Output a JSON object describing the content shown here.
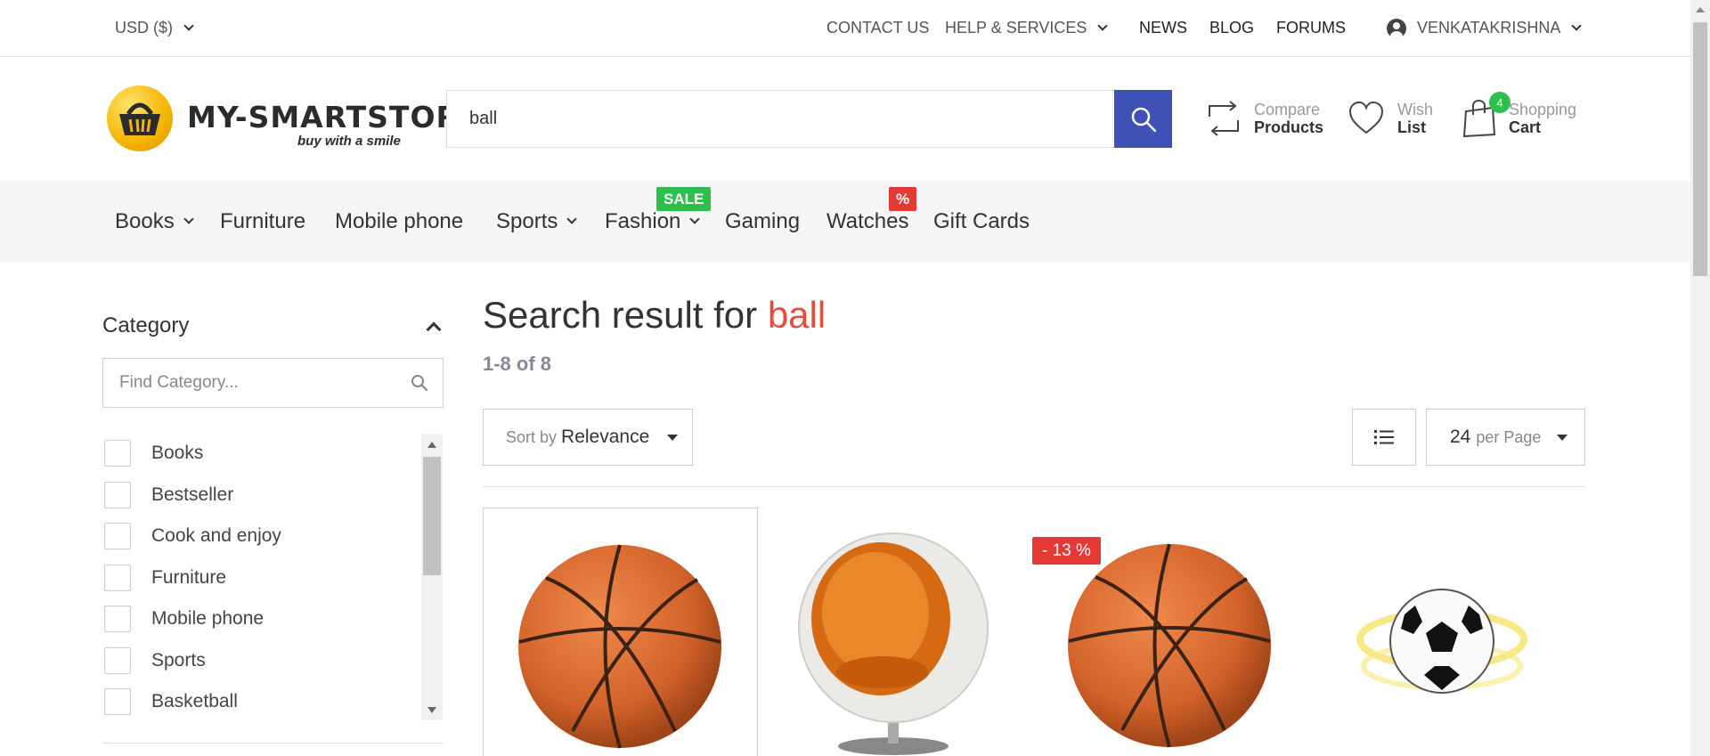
{
  "topbar": {
    "currency": "USD  ($)",
    "contact": "CONTACT US",
    "help": "HELP & SERVICES",
    "news": "NEWS",
    "blog": "BLOG",
    "forums": "FORUMS",
    "user": "VENKATAKRISHNA"
  },
  "logo": {
    "title": "MY-SMARTSTORE",
    "tagline": "buy with a smile"
  },
  "search": {
    "value": "ball"
  },
  "header_links": {
    "compare_small": "Compare",
    "compare_big": "Products",
    "wish_small": "Wish",
    "wish_big": "List",
    "cart_small": "Shopping",
    "cart_big": "Cart",
    "cart_count": "4"
  },
  "nav": {
    "items": [
      "Books",
      "Furniture",
      "Mobile phone",
      "Sports",
      "Fashion",
      "Gaming",
      "Watches",
      "Gift Cards"
    ],
    "sale_badge": "SALE",
    "percent_badge": "%"
  },
  "sidebar": {
    "title": "Category",
    "search_placeholder": "Find Category...",
    "categories": [
      "Books",
      "Bestseller",
      "Cook and enjoy",
      "Furniture",
      "Mobile phone",
      "Sports",
      "Basketball"
    ]
  },
  "results": {
    "title_prefix": "Search result for",
    "query": "ball",
    "count": "1-8 of 8",
    "sort_prefix": "Sort by",
    "sort_value": "Relevance",
    "per_page_value": "24",
    "per_page_suffix": "per Page",
    "discount_badge": "- 13 %"
  },
  "products": [
    {
      "image": "basketball"
    },
    {
      "image": "ball-chair"
    },
    {
      "image": "basketball"
    },
    {
      "image": "soccer-ball"
    }
  ],
  "colors": {
    "accent": "#3f51b5",
    "query": "#e74c3c",
    "sale": "#2ebf4f",
    "discount": "#e53935"
  }
}
